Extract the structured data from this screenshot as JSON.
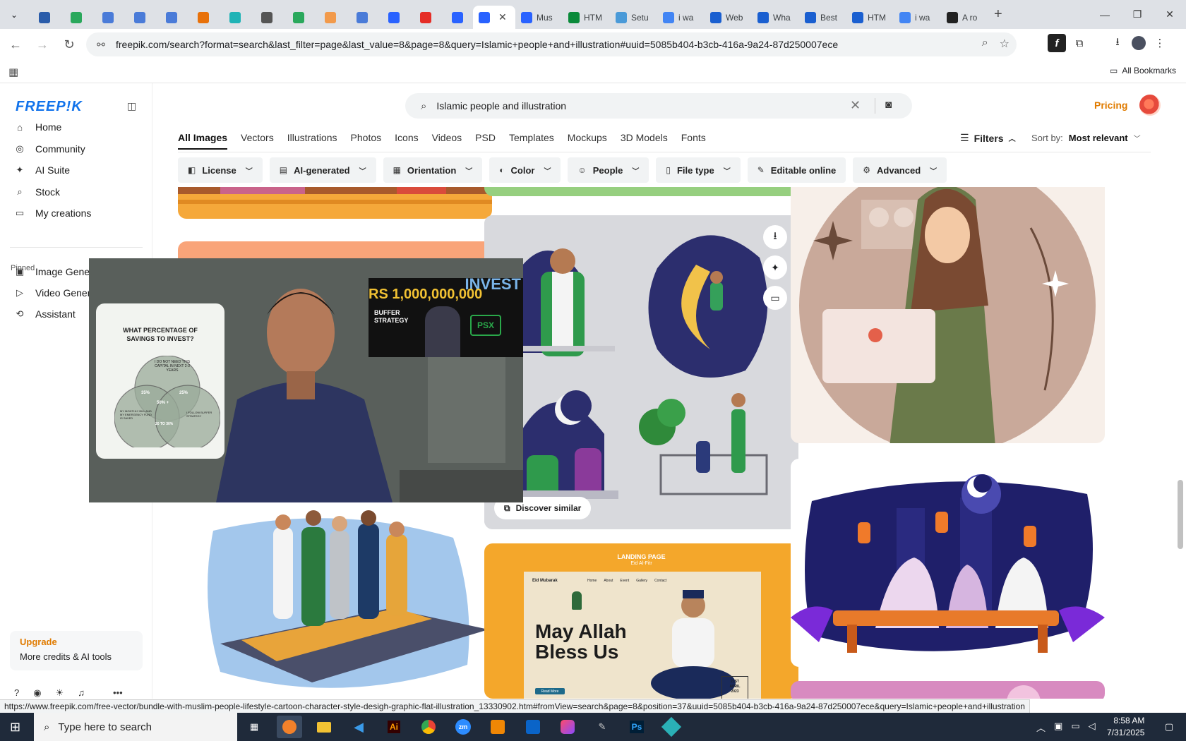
{
  "browser": {
    "tabs": [
      {
        "label": "",
        "color": "#2a5caa"
      },
      {
        "label": "",
        "color": "#2aa85c"
      },
      {
        "label": "",
        "color": "#4a7bd8"
      },
      {
        "label": "",
        "color": "#4a7bd8"
      },
      {
        "label": "",
        "color": "#4a7bd8"
      },
      {
        "label": "",
        "color": "#e8710a"
      },
      {
        "label": "",
        "color": "#1fb3b6"
      },
      {
        "label": "",
        "color": "#555555"
      },
      {
        "label": "",
        "color": "#2aa85c"
      },
      {
        "label": "",
        "color": "#f29a4b"
      },
      {
        "label": "",
        "color": "#4a7bd8"
      },
      {
        "label": "",
        "color": "#2962ff"
      },
      {
        "label": "",
        "color": "#e52d27"
      },
      {
        "label": "",
        "color": "#2962ff"
      }
    ],
    "active_tab": {
      "label": "",
      "color": "#2962ff"
    },
    "labeled_tabs": [
      {
        "label": "Mus",
        "color": "#2962ff"
      },
      {
        "label": "HTM",
        "color": "#0a8a3a"
      },
      {
        "label": "Setu",
        "color": "#4a9ad8"
      },
      {
        "label": "i wa",
        "color": "#4285f4"
      },
      {
        "label": "Web",
        "color": "#1a5fd0"
      },
      {
        "label": "Wha",
        "color": "#1a5fd0"
      },
      {
        "label": "Best",
        "color": "#1a5fd0"
      },
      {
        "label": "HTM",
        "color": "#1a5fd0"
      },
      {
        "label": "i wa",
        "color": "#4285f4"
      },
      {
        "label": "A ro",
        "color": "#222222"
      }
    ],
    "url": "freepik.com/search?format=search&last_filter=page&last_value=8&page=8&query=Islamic+people+and+illustration#uuid=5085b404-b3cb-416a-9a24-87d250007ece",
    "bookmarks_label": "All Bookmarks",
    "status_url": "https://www.freepik.com/free-vector/bundle-with-muslim-people-lifestyle-cartoon-character-style-desigh-graphic-flat-illustration_13330902.htm#fromView=search&page=8&position=37&uuid=5085b404-b3cb-416a-9a24-87d250007ece&query=Islamic+people+and+illustration"
  },
  "sidebar": {
    "logo": "FREEP!K",
    "nav": [
      {
        "label": "Home",
        "icon": "home-icon",
        "glyph": "⌂"
      },
      {
        "label": "Community",
        "icon": "globe-icon",
        "glyph": "◎"
      },
      {
        "label": "AI Suite",
        "icon": "sparkle-icon",
        "glyph": "✦"
      },
      {
        "label": "Stock",
        "icon": "search-icon",
        "glyph": "⌕"
      },
      {
        "label": "My creations",
        "icon": "folder-icon",
        "glyph": "▭"
      }
    ],
    "pinned_label": "Pinned",
    "pinned": [
      {
        "label": "Image Genera",
        "icon": "image-icon",
        "glyph": "▣"
      },
      {
        "label": "Video Genera",
        "icon": "video-icon",
        "glyph": "▷"
      },
      {
        "label": "Assistant",
        "icon": "assistant-icon",
        "glyph": "⟲"
      }
    ],
    "upgrade_title": "Upgrade",
    "upgrade_sub": "More credits & AI tools"
  },
  "search": {
    "query": "Islamic people and illustration"
  },
  "header": {
    "pricing": "Pricing",
    "type_tabs": [
      "All Images",
      "Vectors",
      "Illustrations",
      "Photos",
      "Icons",
      "Videos",
      "PSD",
      "Templates",
      "Mockups",
      "3D Models",
      "Fonts"
    ],
    "filters_label": "Filters",
    "sort_label": "Sort by:",
    "sort_value": "Most relevant",
    "filter_chips": [
      {
        "label": "License",
        "icon": "license-icon",
        "glyph": "◧"
      },
      {
        "label": "AI-generated",
        "icon": "ai-icon",
        "glyph": "▤"
      },
      {
        "label": "Orientation",
        "icon": "orientation-icon",
        "glyph": "▦"
      },
      {
        "label": "Color",
        "icon": "palette-icon",
        "glyph": "◐"
      },
      {
        "label": "People",
        "icon": "people-icon",
        "glyph": "☺"
      },
      {
        "label": "File type",
        "icon": "file-icon",
        "glyph": "▯"
      },
      {
        "label": "Editable online",
        "icon": "pen-icon",
        "glyph": "✎"
      },
      {
        "label": "Advanced",
        "icon": "gear-icon",
        "glyph": "⚙"
      }
    ]
  },
  "gallery": {
    "discover_similar": "Discover similar",
    "landing": {
      "top_label": "LANDING PAGE",
      "sub_label": "Eid Al-Fitr",
      "brand": "Eid Mubarak",
      "headline_1": "May Allah",
      "headline_2": "Bless Us",
      "nav_items": [
        "Home",
        "About",
        "Event",
        "Gallery",
        "Contact"
      ],
      "button": "Read More",
      "date_1": "21ST",
      "date_2": "APRIL",
      "date_3": "2023"
    }
  },
  "video_overlay": {
    "card_title": "WHAT PERCENTAGE OF SAVINGS TO INVEST?",
    "venn_top": "I DO NOT NEED THIS CAPITAL IN NEXT 2-3 YEARS",
    "venn_left": "MY MONTHLY BILL AND MY EMERGENCY FUND IS SAVED",
    "venn_right": "I FOLLOW BUFFER STRATEGY",
    "pct_left": "35%",
    "pct_right": "25%",
    "pct_center": "50% +",
    "pct_bottom": "20 TO 30%",
    "thumb_amount": "RS 1,000,000,000",
    "thumb_invest": "INVEST",
    "thumb_buffer": "BUFFER STRATEGY",
    "thumb_psx": "PSX"
  },
  "taskbar": {
    "search_placeholder": "Type here to search",
    "time": "8:58 AM",
    "date": "7/31/2025"
  }
}
